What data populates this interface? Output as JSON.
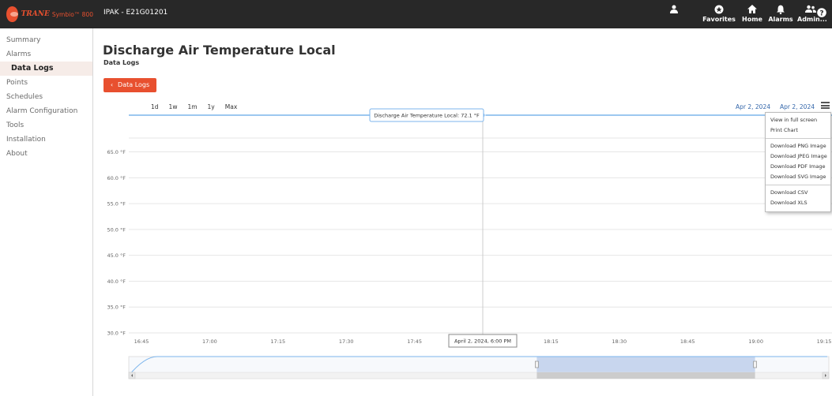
{
  "brand": {
    "trane": "TRANE",
    "product": "Symbio™ 800"
  },
  "header": {
    "site_name": "IPAK - E21G01201",
    "nav": [
      {
        "label": "",
        "icon": "user-icon"
      },
      {
        "label": "Favorites",
        "icon": "star-icon"
      },
      {
        "label": "Home",
        "icon": "home-icon"
      },
      {
        "label": "Alarms",
        "icon": "bell-icon"
      },
      {
        "label": "Admin...",
        "icon": "users-icon"
      },
      {
        "label": "",
        "icon": "help-icon"
      }
    ]
  },
  "sidebar": {
    "items": [
      {
        "label": "Summary",
        "active": false
      },
      {
        "label": "Alarms",
        "active": false
      },
      {
        "label": "Data Logs",
        "active": true
      },
      {
        "label": "Points",
        "active": false
      },
      {
        "label": "Schedules",
        "active": false
      },
      {
        "label": "Alarm Configuration",
        "active": false
      },
      {
        "label": "Tools",
        "active": false
      },
      {
        "label": "Installation",
        "active": false
      },
      {
        "label": "About",
        "active": false
      }
    ]
  },
  "main": {
    "title": "Discharge Air Temperature Local",
    "subtitle": "Data Logs",
    "back_button": "Data Logs",
    "range_buttons": [
      "1d",
      "1w",
      "1m",
      "1y",
      "Max"
    ],
    "date_from": "Apr 2, 2024",
    "date_to": "Apr 2, 2024"
  },
  "export_menu": {
    "groups": [
      [
        "View in full screen",
        "Print Chart"
      ],
      [
        "Download PNG Image",
        "Download JPEG Image",
        "Download PDF Image",
        "Download SVG Image"
      ],
      [
        "Download CSV",
        "Download XLS"
      ]
    ]
  },
  "chart_data": {
    "type": "line",
    "title": "",
    "ylabel": "",
    "xlabel": "",
    "ylim": [
      30.0,
      72.1
    ],
    "y_ticks": [
      "65.0 °F",
      "60.0 °F",
      "55.0 °F",
      "50.0 °F",
      "45.0 °F",
      "40.0 °F",
      "35.0 °F",
      "30.0 °F"
    ],
    "y_tick_values": [
      65,
      60,
      55,
      50,
      45,
      40,
      35,
      30
    ],
    "x_ticks": [
      "16:45",
      "17:00",
      "17:15",
      "17:30",
      "17:45",
      "18:00",
      "18:15",
      "18:30",
      "18:45",
      "19:00",
      "19:15"
    ],
    "series": [
      {
        "name": "Discharge Air Temperature Local",
        "unit": "°F",
        "color": "#7cb5ec",
        "points": [
          {
            "x": "16:45",
            "y": 72.1
          },
          {
            "x": "19:15",
            "y": 72.1
          }
        ]
      }
    ],
    "tooltip": {
      "text": "Discharge Air Temperature Local: 72.1 °F",
      "x": "18:00",
      "y": 72.1
    },
    "crosshair_label": "April 2, 2024, 6:00 PM",
    "navigator": {
      "selected_range": [
        "18:15",
        "19:00"
      ]
    }
  }
}
